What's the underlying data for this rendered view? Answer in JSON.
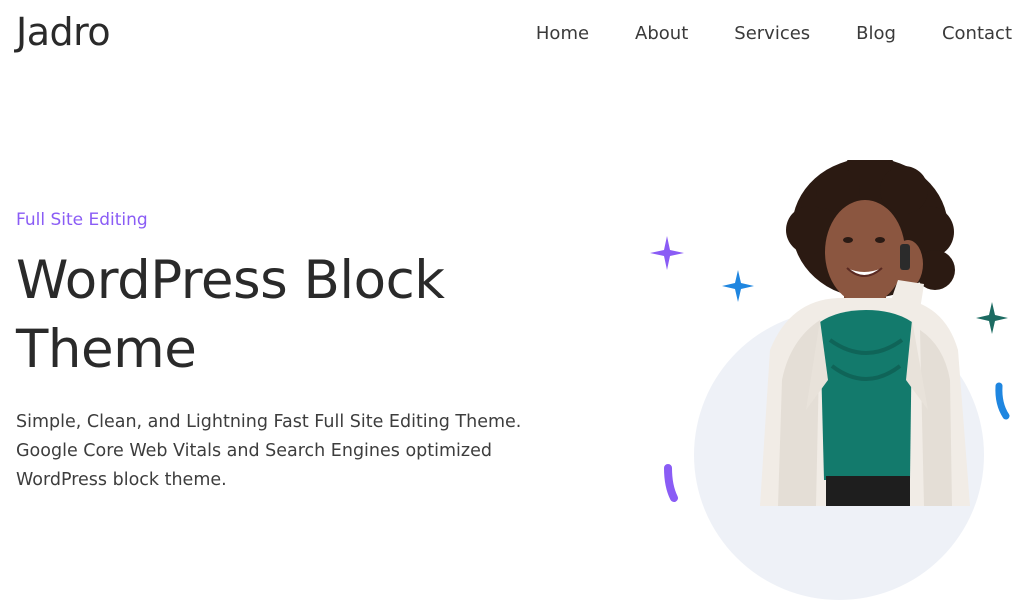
{
  "header": {
    "logo": "Jadro",
    "nav": [
      "Home",
      "About",
      "Services",
      "Blog",
      "Contact"
    ]
  },
  "hero": {
    "eyebrow": "Full Site Editing",
    "title": "WordPress Block Theme",
    "description": "Simple, Clean, and Lightning Fast Full Site Editing Theme. Google Core Web Vitals and Search Engines optimized WordPress block theme."
  },
  "colors": {
    "accent_purple": "#8a5cf5",
    "star_blue": "#1f86e0",
    "star_teal": "#1c6b62",
    "blouse_teal": "#137a6c",
    "blazer": "#f1ece6"
  },
  "illustration": {
    "subject": "woman-on-phone",
    "decorations": [
      "purple-star-icon",
      "blue-star-icon",
      "teal-star-icon",
      "blue-stroke",
      "purple-stroke"
    ]
  }
}
